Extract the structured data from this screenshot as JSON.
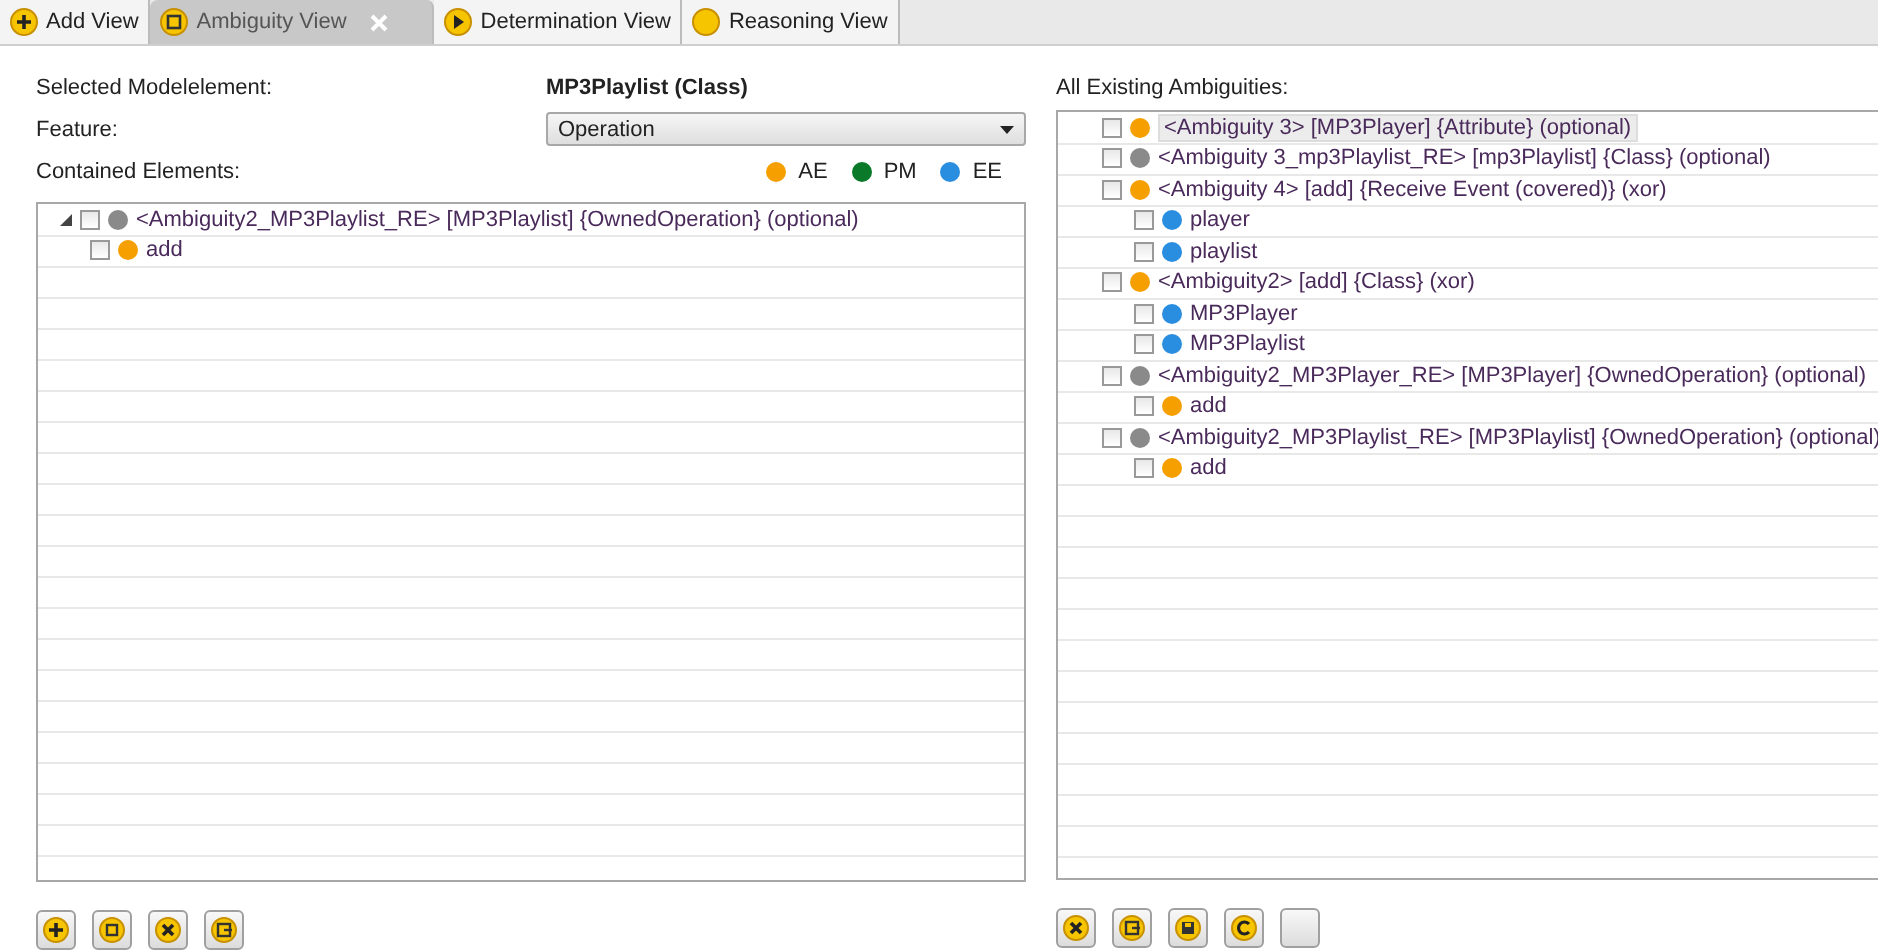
{
  "tabs": [
    {
      "label": "Add View",
      "kind": "plus",
      "selected": false,
      "closable": false
    },
    {
      "label": "Ambiguity View",
      "kind": "note",
      "selected": true,
      "closable": true
    },
    {
      "label": "Determination View",
      "kind": "play",
      "selected": false,
      "closable": false
    },
    {
      "label": "Reasoning View",
      "kind": "dot",
      "selected": false,
      "closable": false
    }
  ],
  "left": {
    "selected_label": "Selected Modelelement:",
    "selected_value": "MP3Playlist (Class)",
    "feature_label": "Feature:",
    "feature": {
      "value": "Operation"
    },
    "contained_label": "Contained Elements:",
    "legend": [
      {
        "label": "AE",
        "color": "#f5a000"
      },
      {
        "label": "PM",
        "color": "#0a7a2a"
      },
      {
        "label": "EE",
        "color": "#2a8ee0"
      }
    ],
    "tree": [
      {
        "label": "<Ambiguity2_MP3Playlist_RE>  [MP3Playlist] {OwnedOperation} (optional)",
        "color": "#8a8a8a",
        "checked": false,
        "expanded": true,
        "children": [
          {
            "label": "add",
            "color": "#f5a000",
            "checked": false
          }
        ]
      }
    ],
    "buttons": [
      {
        "kind": "add"
      },
      {
        "kind": "edit"
      },
      {
        "kind": "delete"
      },
      {
        "kind": "export"
      }
    ]
  },
  "right": {
    "title": "All Existing Ambiguities:",
    "tree": [
      {
        "label": "<Ambiguity 3>  [MP3Player] {Attribute} (optional)",
        "color": "#f5a000",
        "checked": false,
        "selected": true
      },
      {
        "label": "<Ambiguity 3_mp3Playlist_RE>  [mp3Playlist] {Class} (optional)",
        "color": "#8a8a8a",
        "checked": false,
        "selected": false
      },
      {
        "label": "<Ambiguity 4>  [add] {Receive Event (covered)} (xor)",
        "color": "#f5a000",
        "checked": false,
        "selected": false,
        "children": [
          {
            "label": "player",
            "color": "#2a8ee0",
            "checked": false,
            "selected": false
          },
          {
            "label": "playlist",
            "color": "#2a8ee0",
            "checked": false,
            "selected": false
          }
        ]
      },
      {
        "label": "<Ambiguity2>  [add] {Class} (xor)",
        "color": "#f5a000",
        "checked": false,
        "selected": false,
        "children": [
          {
            "label": "MP3Player",
            "color": "#2a8ee0",
            "checked": false,
            "selected": false
          },
          {
            "label": "MP3Playlist",
            "color": "#2a8ee0",
            "checked": false,
            "selected": false
          }
        ]
      },
      {
        "label": "<Ambiguity2_MP3Player_RE>  [MP3Player] {OwnedOperation} (optional)",
        "color": "#8a8a8a",
        "checked": false,
        "selected": false,
        "children": [
          {
            "label": "add",
            "color": "#f5a000",
            "checked": false,
            "selected": false
          }
        ]
      },
      {
        "label": "<Ambiguity2_MP3Playlist_RE>  [MP3Playlist] {OwnedOperation} (optional)",
        "color": "#8a8a8a",
        "checked": false,
        "selected": false,
        "children": [
          {
            "label": "add",
            "color": "#f5a000",
            "checked": false,
            "selected": false
          }
        ]
      }
    ],
    "buttons": [
      {
        "kind": "delete"
      },
      {
        "kind": "export"
      },
      {
        "kind": "save"
      },
      {
        "kind": "refresh"
      },
      {
        "kind": "blank"
      }
    ]
  }
}
